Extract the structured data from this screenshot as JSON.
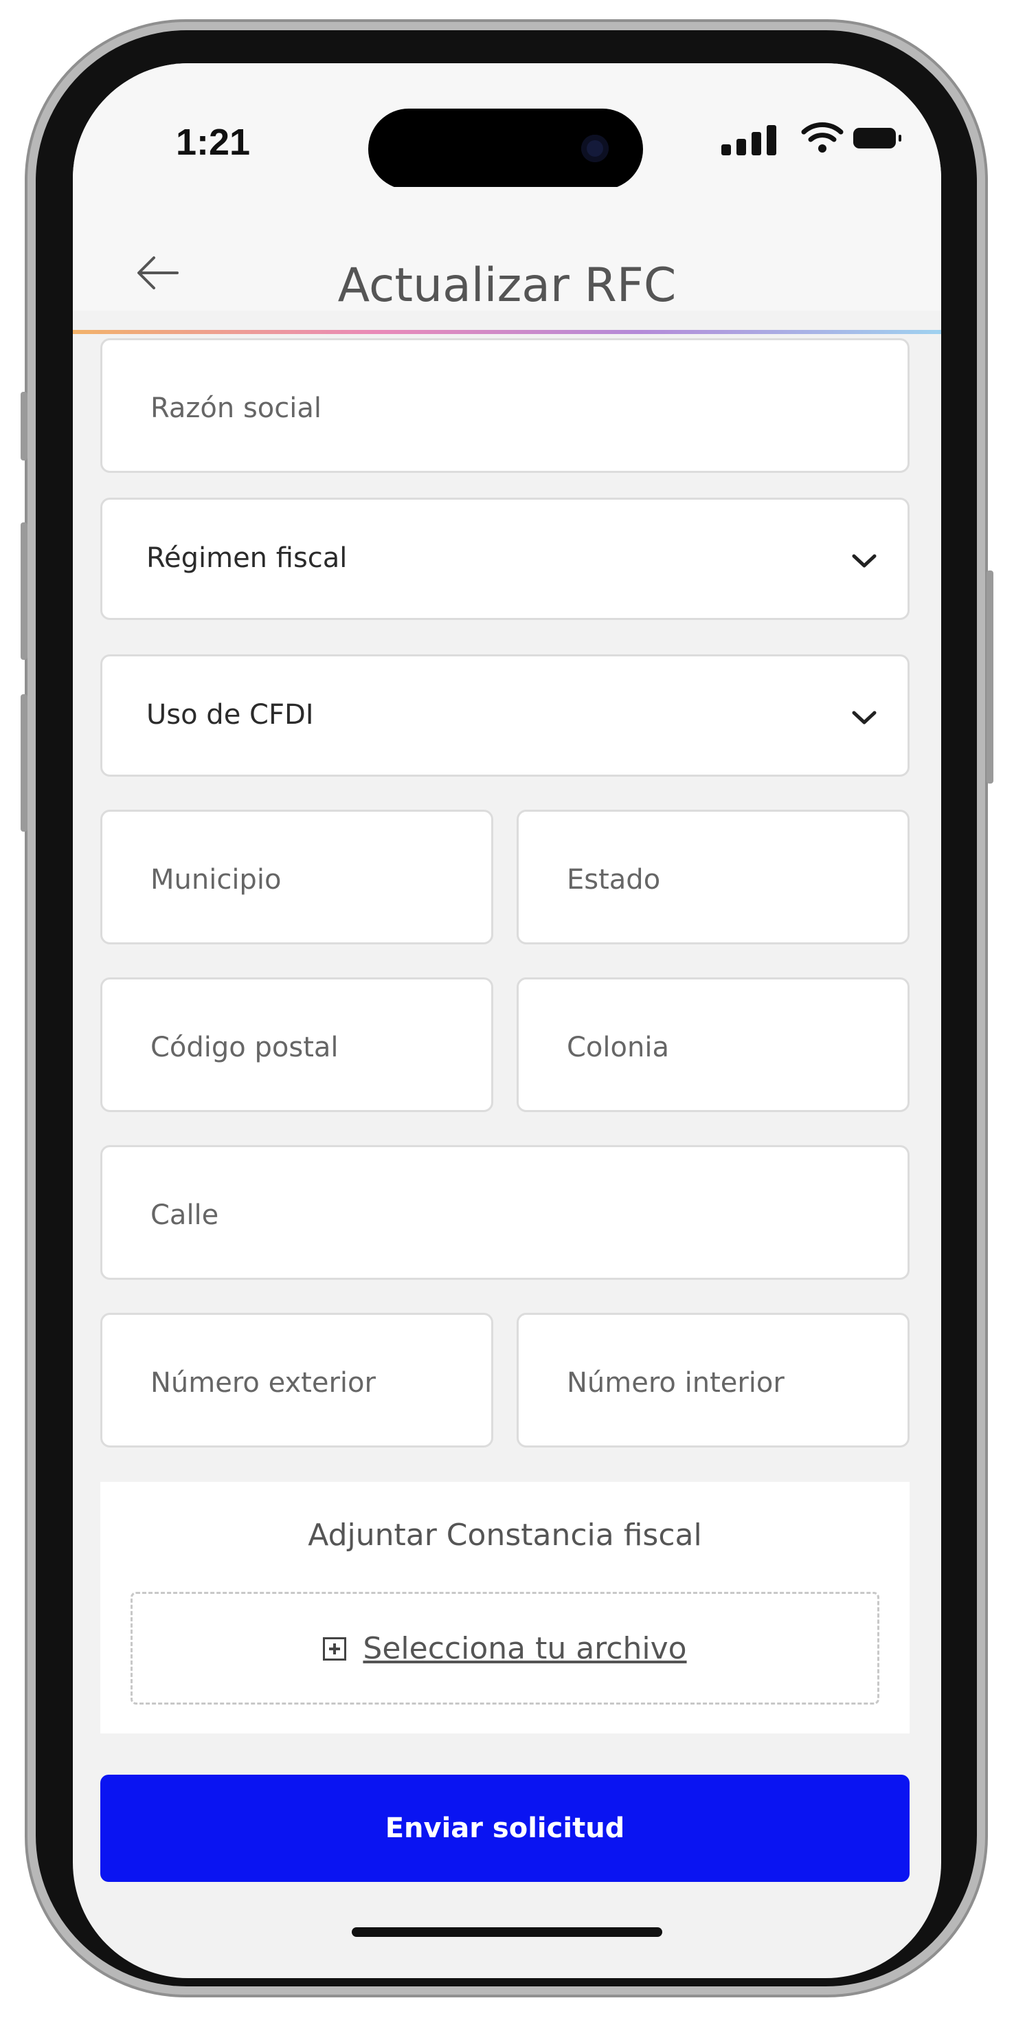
{
  "status_bar": {
    "time": "1:21"
  },
  "header": {
    "title": "Actualizar RFC"
  },
  "form": {
    "razon_social": "Razón social",
    "regimen_fiscal": "Régimen fiscal",
    "uso_cfdi": "Uso de CFDI",
    "municipio": "Municipio",
    "estado": "Estado",
    "codigo_postal": "Código postal",
    "colonia": "Colonia",
    "calle": "Calle",
    "numero_exterior": "Número exterior",
    "numero_interior": "Número interior"
  },
  "attachment": {
    "title": "Adjuntar Constancia fiscal",
    "select_label": "Selecciona tu archivo"
  },
  "actions": {
    "submit_label": "Enviar solicitud"
  },
  "colors": {
    "primary_button": "#0a14f2",
    "background": "#f2f2f2"
  },
  "icons": [
    "back-arrow-icon",
    "chevron-down-icon",
    "add-file-icon",
    "signal-icon",
    "wifi-icon",
    "battery-icon"
  ]
}
